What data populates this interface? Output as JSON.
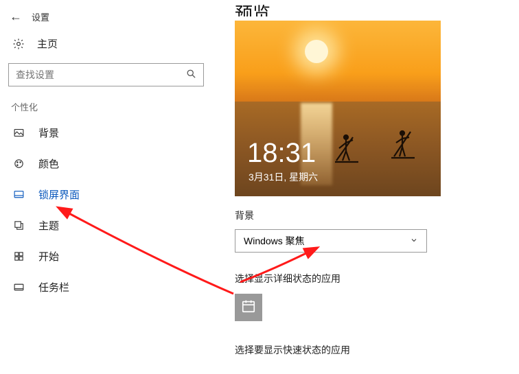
{
  "topbar": {
    "title": "设置"
  },
  "home": {
    "label": "主页"
  },
  "search": {
    "placeholder": "查找设置"
  },
  "section": {
    "label": "个性化"
  },
  "sidebar": {
    "items": [
      {
        "label": "背景"
      },
      {
        "label": "颜色"
      },
      {
        "label": "锁屏界面"
      },
      {
        "label": "主题"
      },
      {
        "label": "开始"
      },
      {
        "label": "任务栏"
      }
    ]
  },
  "main": {
    "title": "预览",
    "preview_time": "18:31",
    "preview_date": "3月31日, 星期六",
    "bg_label": "背景",
    "bg_value": "Windows 聚焦",
    "detail_label": "选择显示详细状态的应用",
    "quick_label": "选择要显示快速状态的应用"
  }
}
